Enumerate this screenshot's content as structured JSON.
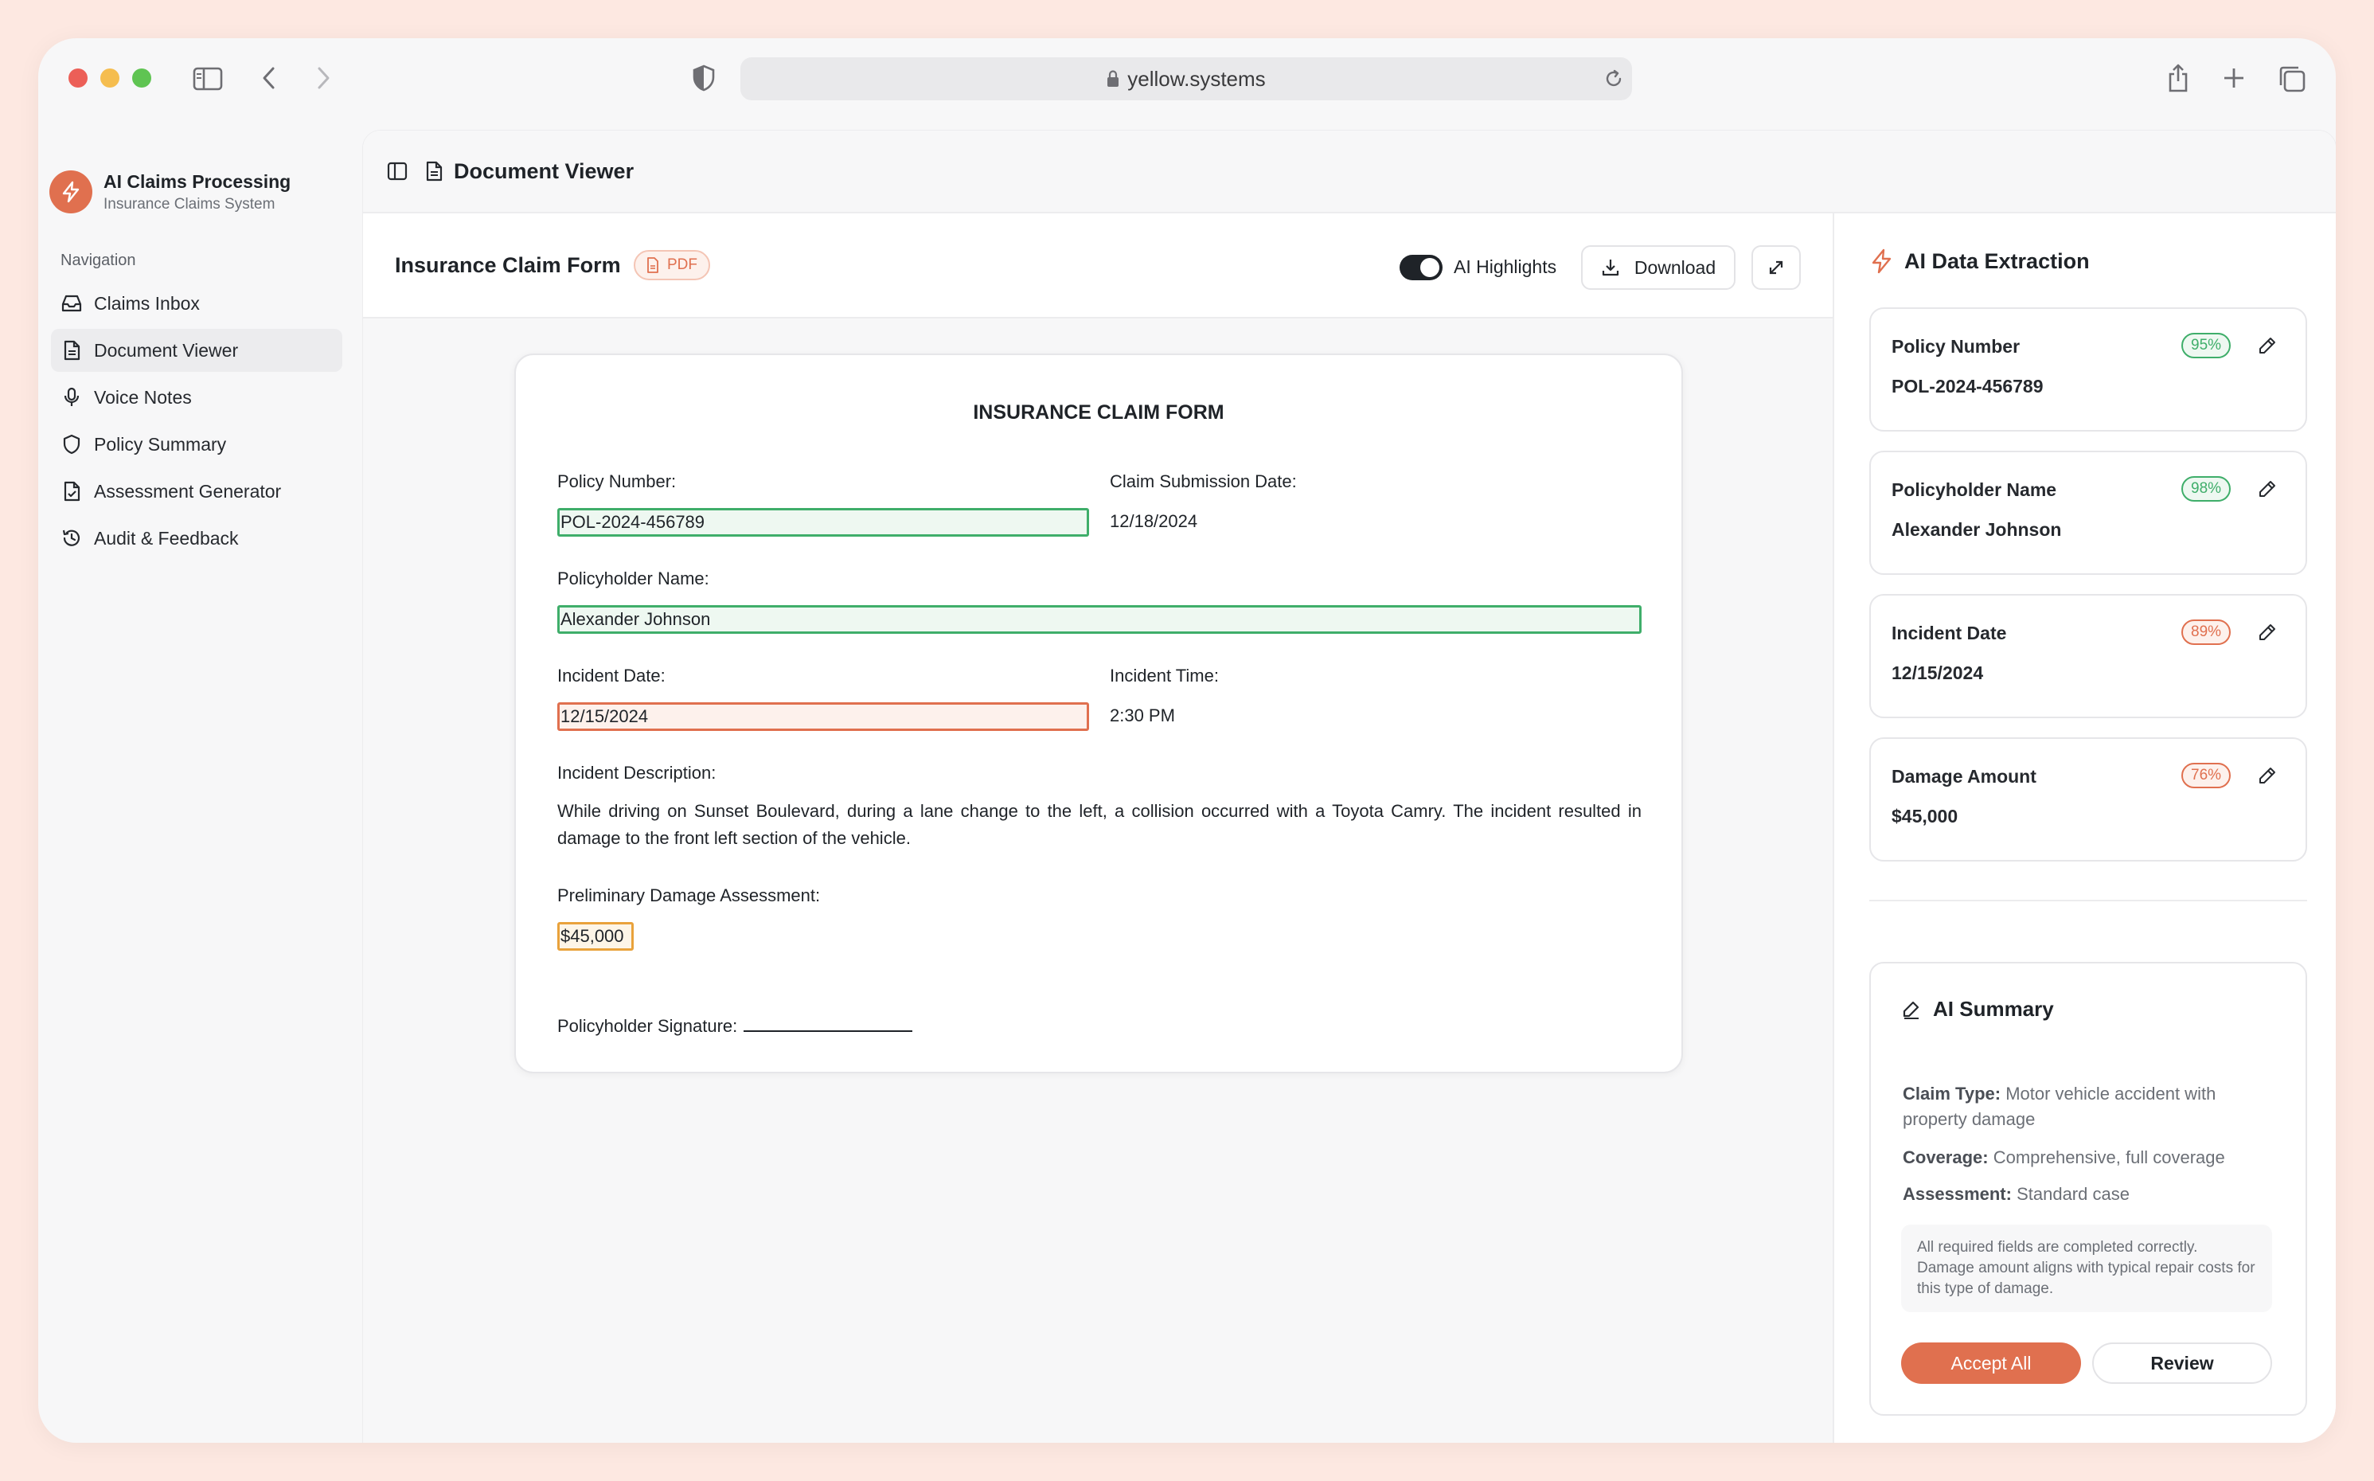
{
  "browser": {
    "url": "yellow.systems"
  },
  "sidebar": {
    "brand_title": "AI Claims Processing",
    "brand_subtitle": "Insurance Claims System",
    "nav_heading": "Navigation",
    "items": [
      {
        "label": "Claims Inbox",
        "icon": "inbox-icon"
      },
      {
        "label": "Document Viewer",
        "icon": "document-icon",
        "active": true
      },
      {
        "label": "Voice Notes",
        "icon": "microphone-icon"
      },
      {
        "label": "Policy Summary",
        "icon": "shield-icon"
      },
      {
        "label": "Assessment Generator",
        "icon": "file-check-icon"
      },
      {
        "label": "Audit & Feedback",
        "icon": "history-icon"
      }
    ]
  },
  "header": {
    "title": "Document Viewer"
  },
  "doc_toolbar": {
    "title": "Insurance Claim Form",
    "badge": "PDF",
    "ai_highlights_label": "AI Highlights",
    "ai_highlights_on": true,
    "download_label": "Download"
  },
  "form": {
    "title": "INSURANCE CLAIM FORM",
    "policy_number_label": "Policy Number:",
    "policy_number": "POL-2024-456789",
    "submission_date_label": "Claim Submission Date:",
    "submission_date": "12/18/2024",
    "policyholder_label": "Policyholder Name:",
    "policyholder": "Alexander Johnson",
    "incident_date_label": "Incident Date:",
    "incident_date": "12/15/2024",
    "incident_time_label": "Incident Time:",
    "incident_time": "2:30 PM",
    "description_label": "Incident Description:",
    "description": "While driving on Sunset Boulevard, during a lane change to the left, a collision occurred with a Toyota Camry. The incident resulted in damage to the front left section of the vehicle.",
    "damage_label": "Preliminary Damage Assessment:",
    "damage": "$45,000",
    "signature_label": "Policyholder Signature:"
  },
  "extraction": {
    "title": "AI Data Extraction",
    "fields": [
      {
        "label": "Policy Number",
        "value": "POL-2024-456789",
        "confidence": "95%",
        "status": "green"
      },
      {
        "label": "Policyholder Name",
        "value": "Alexander Johnson",
        "confidence": "98%",
        "status": "green"
      },
      {
        "label": "Incident Date",
        "value": "12/15/2024",
        "confidence": "89%",
        "status": "red"
      },
      {
        "label": "Damage Amount",
        "value": "$45,000",
        "confidence": "76%",
        "status": "red"
      }
    ]
  },
  "summary": {
    "title": "AI Summary",
    "claim_type_label": "Claim Type:",
    "claim_type": "Motor vehicle accident with property damage",
    "coverage_label": "Coverage:",
    "coverage": "Comprehensive, full coverage",
    "assessment_label": "Assessment:",
    "assessment": "Standard case",
    "note": "All required fields are completed correctly. Damage amount aligns with typical repair costs for this type of damage.",
    "accept_label": "Accept All",
    "review_label": "Review"
  },
  "colors": {
    "accent": "#e0704f",
    "success": "#3fae6a",
    "warning": "#e9a23b"
  }
}
